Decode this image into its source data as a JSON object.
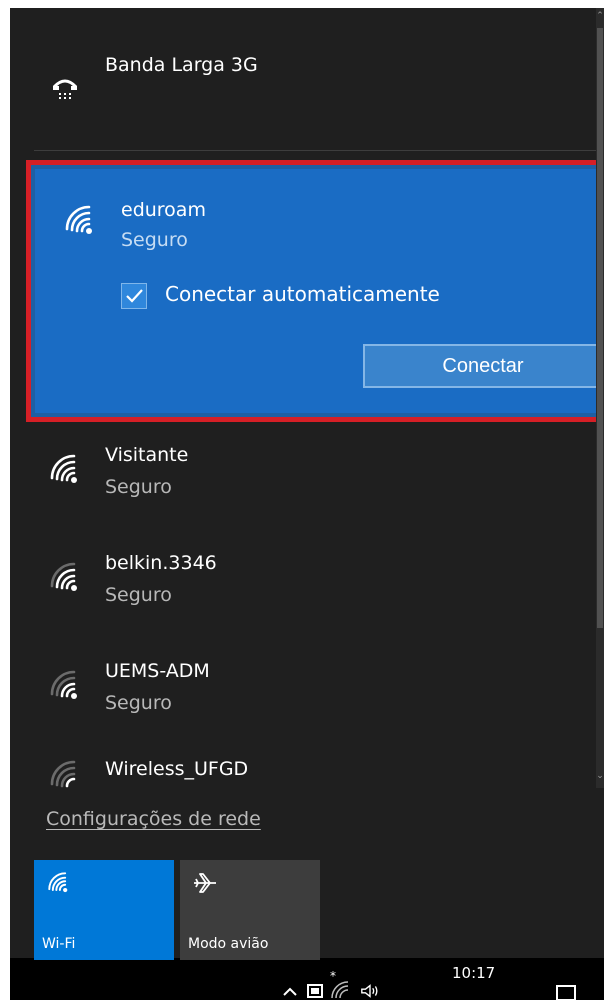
{
  "networks": {
    "dialup": {
      "name": "Banda Larga 3G",
      "icon": "dialup-modem-icon"
    },
    "selected": {
      "name": "eduroam",
      "status": "Seguro",
      "icon": "wifi-secure-icon",
      "auto_connect_label": "Conectar automaticamente",
      "auto_connect_checked": true,
      "connect_label": "Conectar",
      "highlight_color": "#d61f26"
    },
    "list": [
      {
        "name": "Visitante",
        "status": "Seguro",
        "signal": 4
      },
      {
        "name": "belkin.3346",
        "status": "Seguro",
        "signal": 3
      },
      {
        "name": "UEMS-ADM",
        "status": "Seguro",
        "signal": 2
      },
      {
        "name": "Wireless_UFGD",
        "status": "",
        "signal": 1
      }
    ]
  },
  "settings_link": "Configurações de rede",
  "quick_actions": {
    "wifi": {
      "label": "Wi-Fi",
      "icon": "wifi-icon",
      "active": true,
      "color": "#0078d7"
    },
    "airplane": {
      "label": "Modo avião",
      "icon": "airplane-icon",
      "active": false,
      "color": "#3d3d3d"
    }
  },
  "taskbar": {
    "time": "10:17",
    "icons": [
      "chevron-up-icon",
      "battery-icon",
      "wifi-icon",
      "volume-icon",
      "notifications-icon"
    ]
  }
}
